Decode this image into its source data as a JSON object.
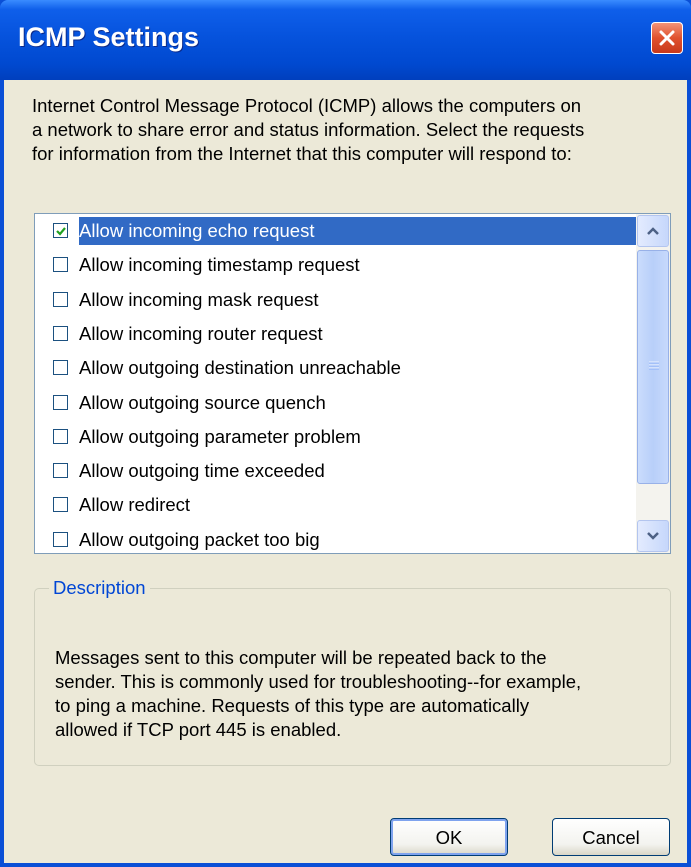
{
  "window": {
    "title": "ICMP Settings",
    "close_icon": "close-icon"
  },
  "intro_text": "Internet Control Message Protocol (ICMP) allows the computers on\na network to share error and status information. Select the requests\nfor information from the Internet that this computer will respond to:",
  "list": {
    "items": [
      {
        "label": "Allow incoming echo request",
        "checked": true,
        "selected": true
      },
      {
        "label": "Allow incoming timestamp request",
        "checked": false,
        "selected": false
      },
      {
        "label": "Allow incoming mask request",
        "checked": false,
        "selected": false
      },
      {
        "label": "Allow incoming router request",
        "checked": false,
        "selected": false
      },
      {
        "label": "Allow outgoing destination unreachable",
        "checked": false,
        "selected": false
      },
      {
        "label": "Allow outgoing source quench",
        "checked": false,
        "selected": false
      },
      {
        "label": "Allow outgoing parameter problem",
        "checked": false,
        "selected": false
      },
      {
        "label": "Allow outgoing time exceeded",
        "checked": false,
        "selected": false
      },
      {
        "label": "Allow redirect",
        "checked": false,
        "selected": false
      },
      {
        "label": "Allow outgoing packet too big",
        "checked": false,
        "selected": false
      }
    ]
  },
  "description": {
    "legend": "Description",
    "text": "Messages sent to this computer will be repeated back to the\nsender. This is commonly used for troubleshooting--for example,\nto ping a machine. Requests of this type are automatically\nallowed if TCP port 445 is enabled."
  },
  "buttons": {
    "ok": "OK",
    "cancel": "Cancel"
  },
  "colors": {
    "title_bar": "#0653dd",
    "selection": "#316ac5",
    "dialog_bg": "#ece9d8",
    "legend_text": "#0046d5",
    "close_button": "#e0512e"
  }
}
